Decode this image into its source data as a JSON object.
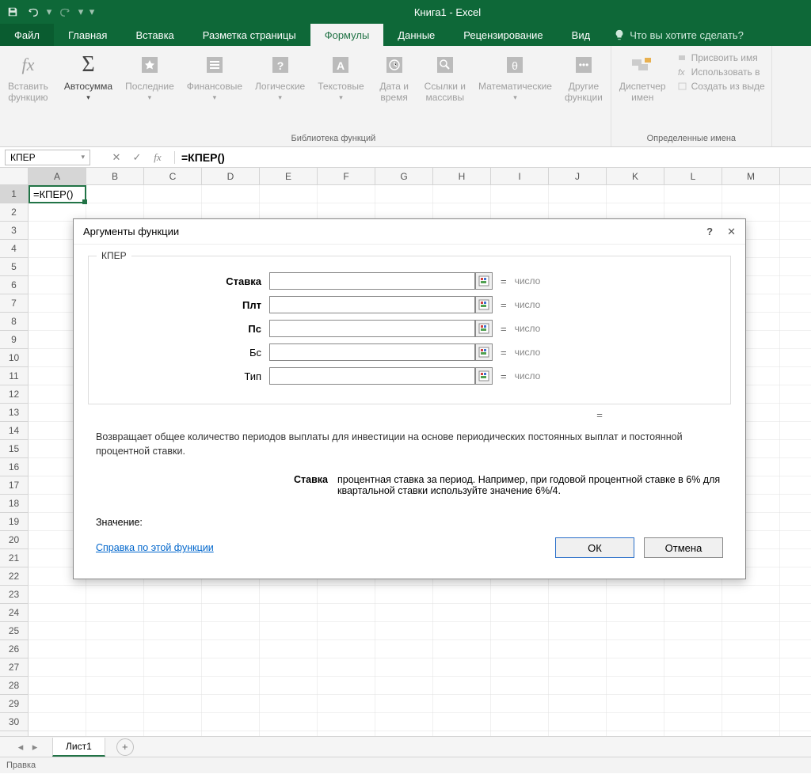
{
  "app_title": "Книга1 - Excel",
  "tabs": {
    "file": "Файл",
    "home": "Главная",
    "insert": "Вставка",
    "page_layout": "Разметка страницы",
    "formulas": "Формулы",
    "data": "Данные",
    "review": "Рецензирование",
    "view": "Вид",
    "tell_me": "Что вы хотите сделать?"
  },
  "ribbon": {
    "insert_function": "Вставить\nфункцию",
    "autosum": "Автосумма",
    "recent": "Последние",
    "financial": "Финансовые",
    "logical": "Логические",
    "text": "Текстовые",
    "date_time": "Дата и\nвремя",
    "lookup": "Ссылки и\nмассивы",
    "math": "Математические",
    "more": "Другие\nфункции",
    "group_library": "Библиотека функций",
    "name_manager": "Диспетчер\nимен",
    "define_name": "Присвоить имя",
    "use_in_formula": "Использовать в",
    "create_from_sel": "Создать из выде",
    "group_defined": "Определенные имена"
  },
  "name_box": "КПЕР",
  "formula_bar": "=КПЕР()",
  "columns": [
    "A",
    "B",
    "C",
    "D",
    "E",
    "F",
    "G",
    "H",
    "I",
    "J",
    "K",
    "L",
    "M"
  ],
  "rows": 30,
  "cell_a1": "=КПЕР()",
  "sheet_tab": "Лист1",
  "status_text": "Правка",
  "dialog": {
    "title": "Аргументы функции",
    "func_name": "КПЕР",
    "args": [
      {
        "name": "Ставка",
        "bold": true,
        "hint": "число"
      },
      {
        "name": "Плт",
        "bold": true,
        "hint": "число"
      },
      {
        "name": "Пс",
        "bold": true,
        "hint": "число"
      },
      {
        "name": "Бс",
        "bold": false,
        "hint": "число"
      },
      {
        "name": "Тип",
        "bold": false,
        "hint": "число"
      }
    ],
    "description": "Возвращает общее количество периодов выплаты для инвестиции на основе периодических постоянных выплат и постоянной процентной ставки.",
    "arg_desc_name": "Ставка",
    "arg_desc_text": "процентная ставка за период. Например, при годовой процентной ставке в 6% для квартальной ставки используйте значение 6%/4.",
    "value_label": "Значение:",
    "help_link": "Справка по этой функции",
    "ok": "ОК",
    "cancel": "Отмена"
  }
}
